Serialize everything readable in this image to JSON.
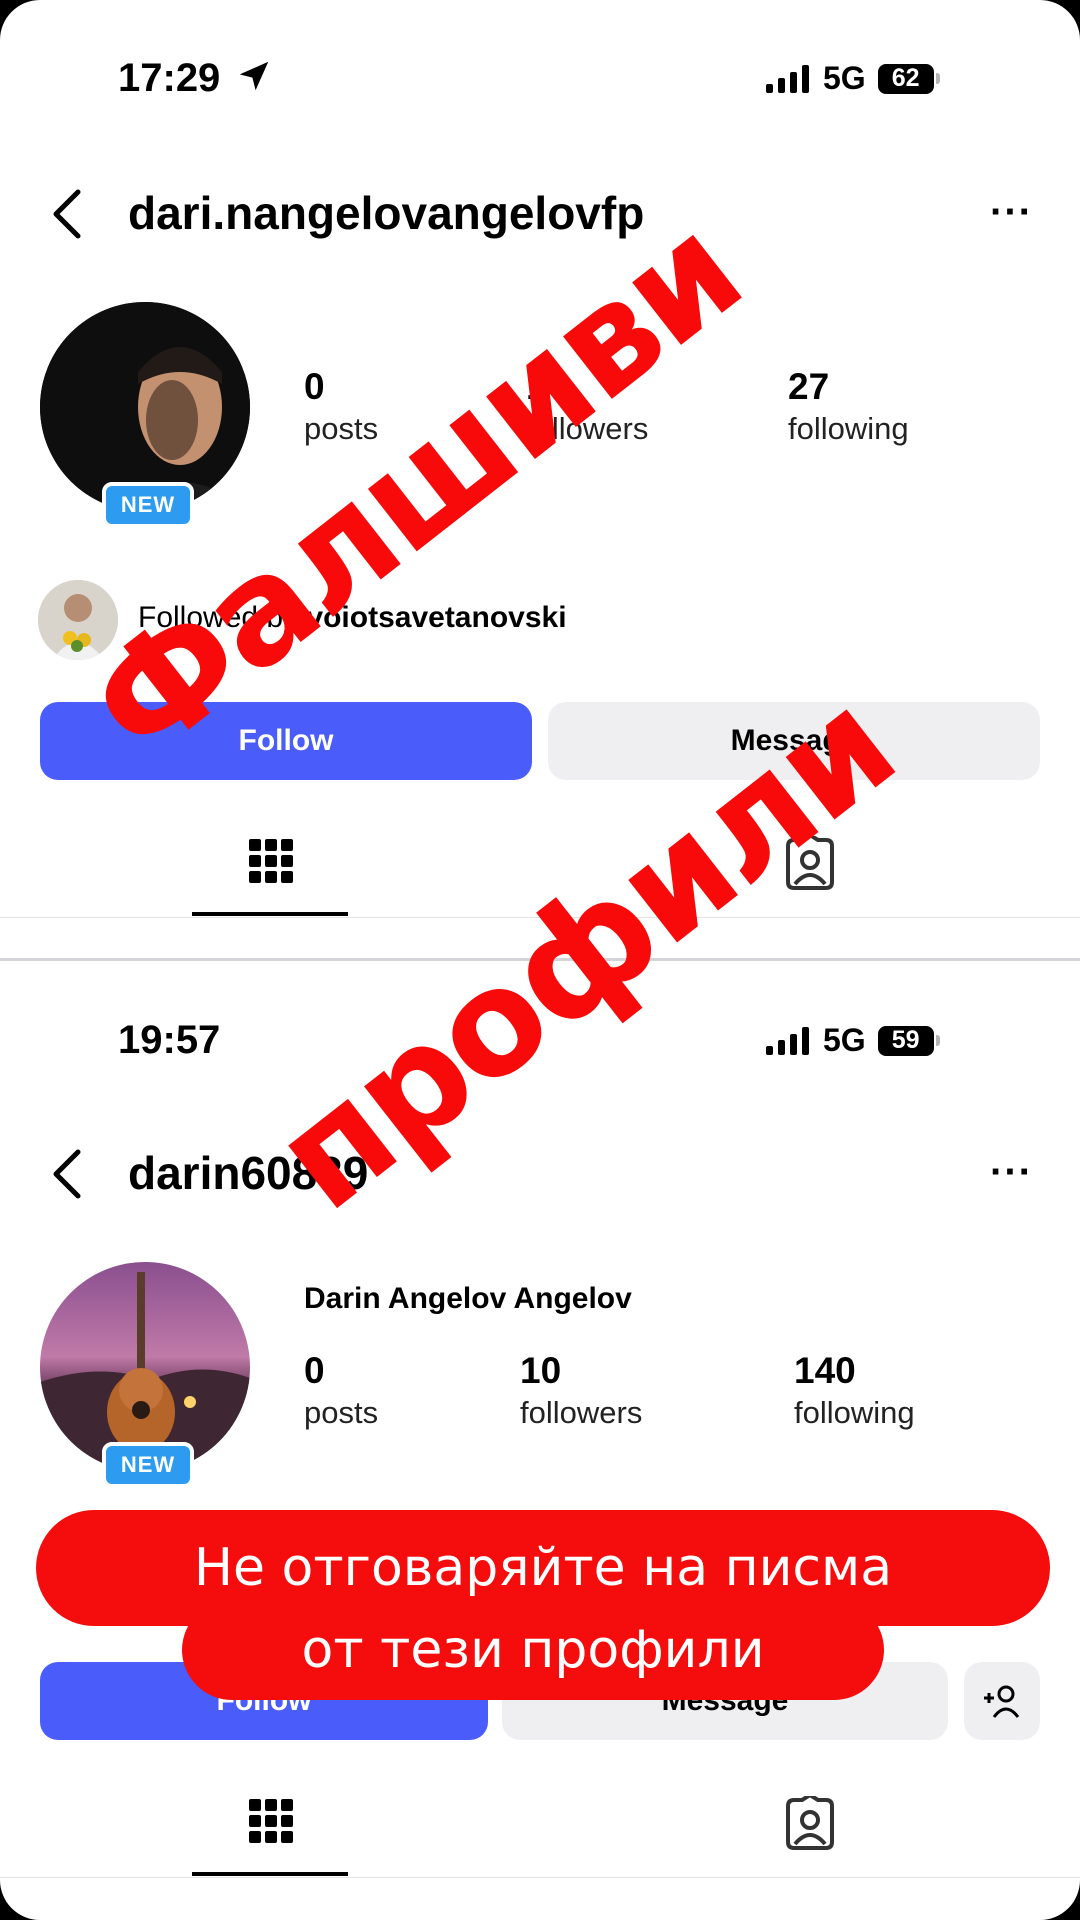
{
  "profile1": {
    "status": {
      "time": "17:29",
      "network": "5G",
      "battery": "62"
    },
    "username": "dari.nangelovangelovfp",
    "badge": "NEW",
    "stats": [
      {
        "value": "0",
        "label": "posts"
      },
      {
        "value": "1",
        "label": "followers"
      },
      {
        "value": "27",
        "label": "following"
      }
    ],
    "followed_by": {
      "prefix": "Followed by ",
      "user": "voiotsavetanovski"
    },
    "buttons": {
      "follow": "Follow",
      "message": "Message"
    }
  },
  "profile2": {
    "status": {
      "time": "19:57",
      "network": "5G",
      "battery": "59"
    },
    "username": "darin60839",
    "full_name": "Darin Angelov Angelov",
    "badge": "NEW",
    "stats": [
      {
        "value": "0",
        "label": "posts"
      },
      {
        "value": "10",
        "label": "followers"
      },
      {
        "value": "140",
        "label": "following"
      }
    ],
    "buttons": {
      "follow": "Follow",
      "message": "Message"
    }
  },
  "overlay": {
    "stamp_line1": "Фалшиви",
    "stamp_line2": "профили",
    "banner_line1": "Не отговаряйте на писма",
    "banner_line2": "от тези профили",
    "color": "#f80a0a"
  },
  "colors": {
    "follow_button": "#4a5dfb",
    "badge": "#2d9cf0",
    "banner": "#f50d0d"
  },
  "icons": [
    "location-arrow-icon",
    "signal-icon",
    "battery-icon",
    "back-chevron-icon",
    "more-options-icon",
    "grid-icon",
    "tagged-icon",
    "add-person-icon"
  ]
}
